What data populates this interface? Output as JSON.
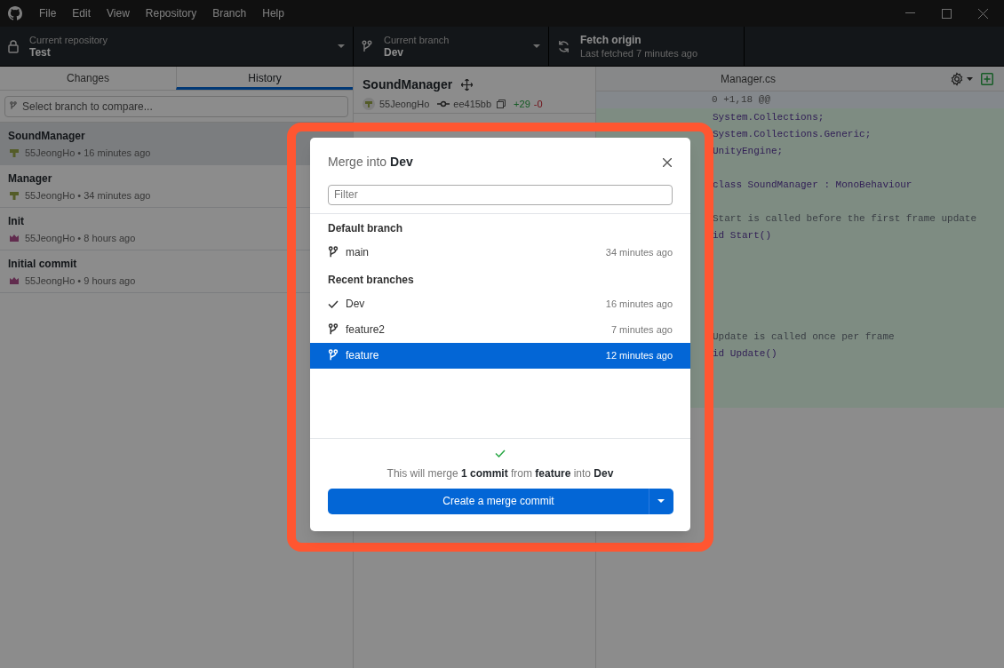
{
  "menu": [
    "File",
    "Edit",
    "View",
    "Repository",
    "Branch",
    "Help"
  ],
  "toolbar": {
    "repository": {
      "label": "Current repository",
      "value": "Test"
    },
    "branch": {
      "label": "Current branch",
      "value": "Dev"
    },
    "fetch": {
      "label": "Fetch origin",
      "detail": "Last fetched 7 minutes ago"
    }
  },
  "tabs": [
    {
      "label": "Changes",
      "selected": false
    },
    {
      "label": "History",
      "selected": true
    }
  ],
  "compare": {
    "placeholder": "Select branch to compare..."
  },
  "commits": [
    {
      "kind": "cross",
      "title": "SoundManager",
      "meta": "55JeongHo • 16 minutes ago",
      "selected": true
    },
    {
      "kind": "cross",
      "title": "Manager",
      "meta": "55JeongHo • 34 minutes ago",
      "selected": false
    },
    {
      "kind": "crown",
      "title": "Init",
      "meta": "55JeongHo • 8 hours ago",
      "selected": false
    },
    {
      "kind": "crown",
      "title": "Initial commit",
      "meta": "55JeongHo • 9 hours ago",
      "selected": false
    }
  ],
  "commit_header": {
    "title": "SoundManager",
    "author": "55JeongHo",
    "sha": "ee415bb",
    "added": "+29",
    "removed": "-0"
  },
  "diff": {
    "file": "Manager.cs",
    "hunk": "0 +1,18 @@",
    "lines": [
      {
        "kind": "code",
        "text": "System.Collections;"
      },
      {
        "kind": "code",
        "text": "System.Collections.Generic;"
      },
      {
        "kind": "code",
        "text": "UnityEngine;"
      },
      {
        "kind": "blank"
      },
      {
        "kind": "code",
        "text": "class SoundManager : MonoBehaviour"
      },
      {
        "kind": "blank"
      },
      {
        "kind": "comment",
        "text": "Start is called before the first frame update"
      },
      {
        "kind": "code",
        "text": "id Start()"
      },
      {
        "kind": "blank"
      },
      {
        "kind": "blank"
      },
      {
        "kind": "blank"
      },
      {
        "kind": "blank"
      },
      {
        "kind": "blank"
      },
      {
        "kind": "comment",
        "text": "Update is called once per frame"
      },
      {
        "kind": "code",
        "text": "id Update()"
      }
    ]
  },
  "dialog": {
    "title": "Merge into **Dev**",
    "filter": {
      "placeholder": "Filter"
    },
    "groups": [
      {
        "heading": "Default branch",
        "branches": [
          {
            "name": "main",
            "time": "34 minutes ago",
            "current": false,
            "selected": false
          }
        ]
      },
      {
        "heading": "Recent branches",
        "branches": [
          {
            "name": "Dev",
            "time": "16 minutes ago",
            "current": true,
            "selected": false
          },
          {
            "name": "feature2",
            "time": "7 minutes ago",
            "current": false,
            "selected": false
          },
          {
            "name": "feature",
            "time": "12 minutes ago",
            "current": false,
            "selected": true
          }
        ]
      }
    ],
    "summary": "This will merge **1 commit** from **feature** into **Dev**",
    "button": "Create a merge commit"
  }
}
